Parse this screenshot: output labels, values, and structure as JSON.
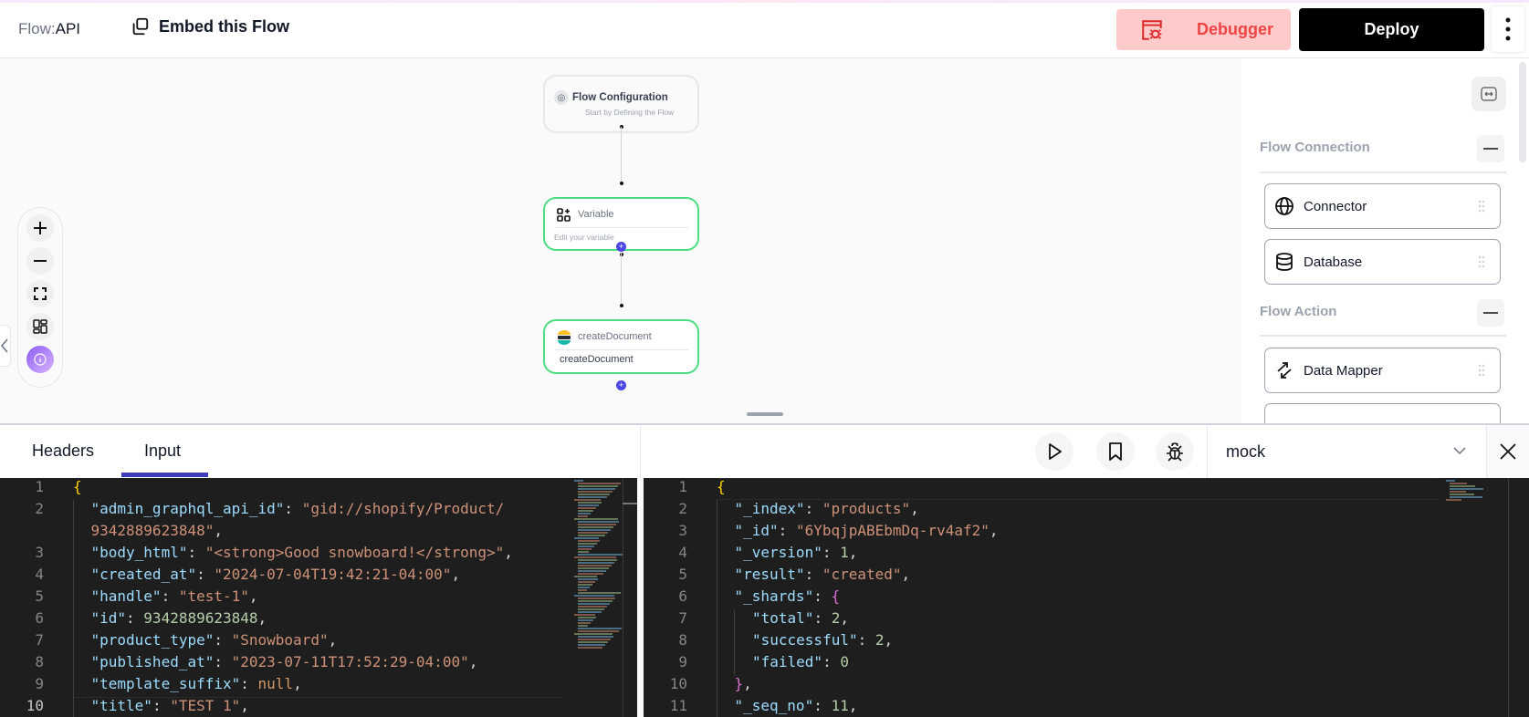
{
  "header": {
    "flow_prefix": "Flow:",
    "flow_name": "API",
    "embed_label": "Embed this Flow",
    "debugger_label": "Debugger",
    "deploy_label": "Deploy"
  },
  "colors": {
    "accent": "#3f3cbb",
    "debugger_bg": "#fecaca",
    "debugger_fg": "#ef4444",
    "node_border": "#4ade80",
    "plus_handle": "#4f46e5"
  },
  "canvas": {
    "nodes": [
      {
        "title": "Flow Configuration",
        "subtitle": "Start by Defining the Flow",
        "icon": "target-icon"
      },
      {
        "title": "Variable",
        "subtitle": "Edit your variable",
        "icon": "variable-icon"
      },
      {
        "title": "createDocument",
        "subtitle": "createDocument",
        "icon": "elastic-icon"
      }
    ],
    "controls": [
      "zoom-in",
      "zoom-out",
      "fit-view",
      "layout",
      "info"
    ]
  },
  "right_panel": {
    "sections": [
      {
        "title": "Flow Connection",
        "items": [
          {
            "label": "Connector",
            "icon": "globe-icon"
          },
          {
            "label": "Database",
            "icon": "database-icon"
          }
        ]
      },
      {
        "title": "Flow Action",
        "items": [
          {
            "label": "Data Mapper",
            "icon": "arrows-icon"
          }
        ]
      }
    ]
  },
  "bottom": {
    "tabs": [
      {
        "label": "Headers"
      },
      {
        "label": "Input",
        "active": true
      }
    ],
    "environment": "mock"
  },
  "input_editor": {
    "lines": [
      {
        "n": "1",
        "tokens": [
          [
            "b1",
            "{"
          ]
        ]
      },
      {
        "n": "2",
        "tokens": [
          [
            "k",
            "\"admin_graphql_api_id\""
          ],
          [
            "p",
            ": "
          ],
          [
            "s",
            "\"gid://shopify/Product/"
          ]
        ]
      },
      {
        "n": "",
        "tokens": [
          [
            "s",
            "9342889623848\""
          ],
          [
            "p",
            ","
          ]
        ]
      },
      {
        "n": "3",
        "tokens": [
          [
            "k",
            "\"body_html\""
          ],
          [
            "p",
            ": "
          ],
          [
            "s",
            "\"<strong>Good snowboard!</strong>\""
          ],
          [
            "p",
            ","
          ]
        ]
      },
      {
        "n": "4",
        "tokens": [
          [
            "k",
            "\"created_at\""
          ],
          [
            "p",
            ": "
          ],
          [
            "s",
            "\"2024-07-04T19:42:21-04:00\""
          ],
          [
            "p",
            ","
          ]
        ]
      },
      {
        "n": "5",
        "tokens": [
          [
            "k",
            "\"handle\""
          ],
          [
            "p",
            ": "
          ],
          [
            "s",
            "\"test-1\""
          ],
          [
            "p",
            ","
          ]
        ]
      },
      {
        "n": "6",
        "tokens": [
          [
            "k",
            "\"id\""
          ],
          [
            "p",
            ": "
          ],
          [
            "n",
            "9342889623848"
          ],
          [
            "p",
            ","
          ]
        ]
      },
      {
        "n": "7",
        "tokens": [
          [
            "k",
            "\"product_type\""
          ],
          [
            "p",
            ": "
          ],
          [
            "s",
            "\"Snowboard\""
          ],
          [
            "p",
            ","
          ]
        ]
      },
      {
        "n": "8",
        "tokens": [
          [
            "k",
            "\"published_at\""
          ],
          [
            "p",
            ": "
          ],
          [
            "s",
            "\"2023-07-11T17:52:29-04:00\""
          ],
          [
            "p",
            ","
          ]
        ]
      },
      {
        "n": "9",
        "tokens": [
          [
            "k",
            "\"template_suffix\""
          ],
          [
            "p",
            ": "
          ],
          [
            "nl",
            "null"
          ],
          [
            "p",
            ","
          ]
        ]
      },
      {
        "n": "10",
        "tokens": [
          [
            "k",
            "\"title\""
          ],
          [
            "p",
            ": "
          ],
          [
            "s",
            "\"TEST 1\""
          ],
          [
            "p",
            ","
          ]
        ],
        "active": true
      }
    ]
  },
  "output_editor": {
    "lines": [
      {
        "n": "1",
        "tokens": [
          [
            "b1",
            "{"
          ]
        ]
      },
      {
        "n": "2",
        "tokens": [
          [
            "k",
            "\"_index\""
          ],
          [
            "p",
            ": "
          ],
          [
            "s",
            "\"products\""
          ],
          [
            "p",
            ","
          ]
        ]
      },
      {
        "n": "3",
        "tokens": [
          [
            "k",
            "\"_id\""
          ],
          [
            "p",
            ": "
          ],
          [
            "s",
            "\"6YbqjpABEbmDq-rv4af2\""
          ],
          [
            "p",
            ","
          ]
        ]
      },
      {
        "n": "4",
        "tokens": [
          [
            "k",
            "\"_version\""
          ],
          [
            "p",
            ": "
          ],
          [
            "n",
            "1"
          ],
          [
            "p",
            ","
          ]
        ]
      },
      {
        "n": "5",
        "tokens": [
          [
            "k",
            "\"result\""
          ],
          [
            "p",
            ": "
          ],
          [
            "s",
            "\"created\""
          ],
          [
            "p",
            ","
          ]
        ]
      },
      {
        "n": "6",
        "tokens": [
          [
            "k",
            "\"_shards\""
          ],
          [
            "p",
            ": "
          ],
          [
            "b2",
            "{"
          ]
        ]
      },
      {
        "n": "7",
        "indent": 2,
        "tokens": [
          [
            "k",
            "\"total\""
          ],
          [
            "p",
            ": "
          ],
          [
            "n",
            "2"
          ],
          [
            "p",
            ","
          ]
        ]
      },
      {
        "n": "8",
        "indent": 2,
        "tokens": [
          [
            "k",
            "\"successful\""
          ],
          [
            "p",
            ": "
          ],
          [
            "n",
            "2"
          ],
          [
            "p",
            ","
          ]
        ]
      },
      {
        "n": "9",
        "indent": 2,
        "tokens": [
          [
            "k",
            "\"failed\""
          ],
          [
            "p",
            ": "
          ],
          [
            "n",
            "0"
          ]
        ]
      },
      {
        "n": "10",
        "tokens": [
          [
            "b2",
            "}"
          ],
          [
            "p",
            ","
          ]
        ]
      },
      {
        "n": "11",
        "tokens": [
          [
            "k",
            "\"_seq_no\""
          ],
          [
            "p",
            ": "
          ],
          [
            "n",
            "11"
          ],
          [
            "p",
            ","
          ]
        ]
      }
    ]
  }
}
